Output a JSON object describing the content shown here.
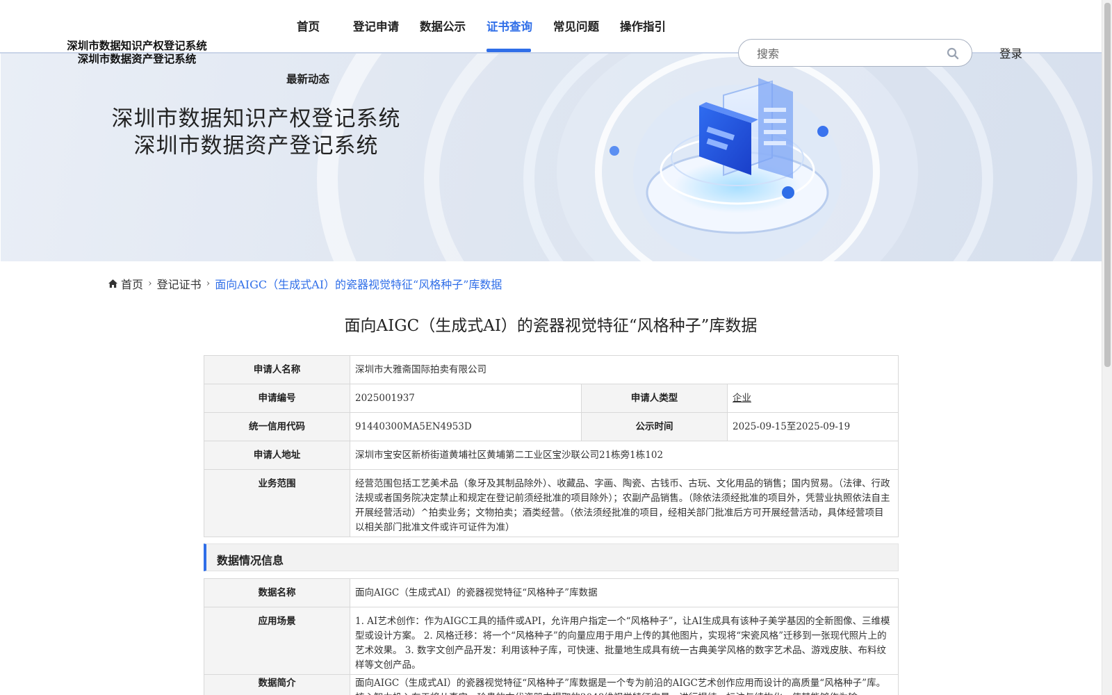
{
  "header": {
    "logo_line1": "深圳市数据知识产权登记系统",
    "logo_line2": "深圳市数据资产登记系统",
    "nav": [
      {
        "label": "首页"
      },
      {
        "label": "登记申请"
      },
      {
        "label": "数据公示"
      },
      {
        "label": "证书查询",
        "active": true
      },
      {
        "label": "常见问题"
      },
      {
        "label": "操作指引"
      }
    ],
    "sub_nav": "最新动态",
    "search_placeholder": "搜索",
    "login": "登录",
    "accent_color": "#2f6ee8"
  },
  "banner": {
    "title_line1": "深圳市数据知识产权登记系统",
    "title_line2": "深圳市数据资产登记系统"
  },
  "breadcrumb": {
    "home": "首页",
    "level1": "登记证书",
    "current": "面向AIGC（生成式AI）的瓷器视觉特征“风格种子”库数据"
  },
  "page_title": "面向AIGC（生成式AI）的瓷器视觉特征“风格种子”库数据",
  "applicant": {
    "name_label": "申请人名称",
    "name": "深圳市大雅斋国际拍卖有限公司",
    "number_label": "申请编号",
    "number": "2025001937",
    "type_label": "申请人类型",
    "type": "企业",
    "credit_label": "统一信用代码",
    "credit": "91440300MA5EN4953D",
    "publicity_label": "公示时间",
    "publicity": "2025-09-15至2025-09-19",
    "address_label": "申请人地址",
    "address": "深圳市宝安区新桥街道黄埔社区黄埔第二工业区宝沙联公司21栋旁1栋102",
    "scope_label": "业务范围",
    "scope": "经营范围包括工艺美术品（象牙及其制品除外）、收藏品、字画、陶瓷、古钱币、古玩、文化用品的销售；国内贸易。（法律、行政法规或者国务院决定禁止和规定在登记前须经批准的项目除外）；农副产品销售。（除依法须经批准的项目外，凭营业执照依法自主开展经营活动）^拍卖业务；文物拍卖；酒类经营。（依法须经批准的项目，经相关部门批准后方可开展经营活动，具体经营项目以相关部门批准文件或许可证件为准）"
  },
  "data_section": {
    "heading": "数据情况信息",
    "name_label": "数据名称",
    "name": "面向AIGC（生成式AI）的瓷器视觉特征“风格种子”库数据",
    "scenario_label": "应用场景",
    "scenario": "1. AI艺术创作：作为AIGC工具的插件或API，允许用户指定一个“风格种子”，让AI生成具有该种子美学基因的全新图像、三维模型或设计方案。 2. 风格迁移：将一个“风格种子”的向量应用于用户上传的其他图片，实现将“宋瓷风格”迁移到一张现代照片上的艺术效果。 3. 数字文创产品开发：利用该种子库，可快速、批量地生成具有统一古典美学风格的数字艺术品、游戏皮肤、布料纹样等文创产品。",
    "intro_label": "数据简介",
    "intro": "面向AIGC（生成式AI）的瓷器视觉特征“风格种子”库数据是一个专为前沿的AIGC艺术创作应用而设计的高质量“风格种子”库。核心智力投入在于将从真实、珍贵的古代瓷器中提取的2048维视觉特征向量，进行提纯、标注与结构化，使其能够作为输"
  }
}
